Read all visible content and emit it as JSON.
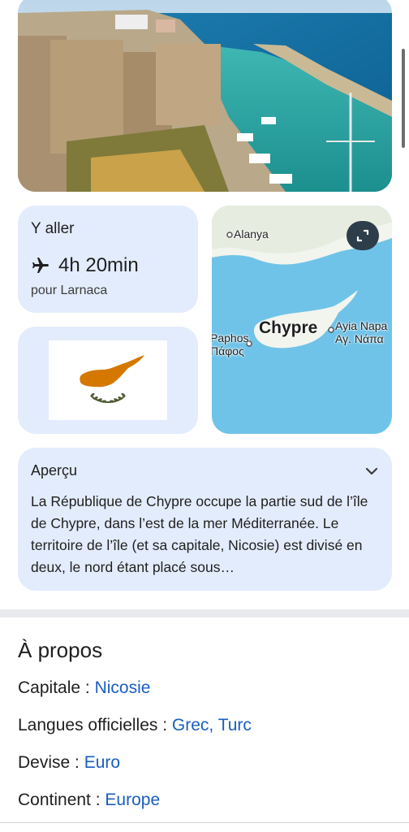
{
  "hero": {
    "alt": "Harbour with castle and boats"
  },
  "travel": {
    "title": "Y aller",
    "duration": "4h 20min",
    "destination": "pour Larnaca"
  },
  "map": {
    "labels": {
      "alanya": "Alanya",
      "chypre": "Chypre",
      "ayia_napa": "Ayia Napa",
      "ayia_napa_gr": "Αγ. Νάπα",
      "paphos": "Paphos",
      "paphos_gr": "Πάφος"
    }
  },
  "overview": {
    "title": "Aperçu",
    "text": "La République de Chypre occupe la partie sud de l’île de Chypre, dans l’est de la mer Méditerranée. Le territoire de l’île (et sa capitale, Nicosie) est divisé en deux, le nord étant placé sous…"
  },
  "about": {
    "title": "À propos",
    "facts": [
      {
        "label": "Capitale : ",
        "value": "Nicosie"
      },
      {
        "label": "Langues officielles : ",
        "value": "Grec, Turc"
      },
      {
        "label": "Devise : ",
        "value": "Euro"
      },
      {
        "label": "Continent : ",
        "value": "Europe"
      }
    ]
  },
  "colors": {
    "card_bg": "#e3ecfc",
    "link": "#1a5ec0",
    "sea": "#6fc3e8",
    "land": "#f2f4ee",
    "flag_orange": "#d57800",
    "flag_green": "#4e5b31"
  },
  "icons": [
    "airplane-icon",
    "expand-icon",
    "chevron-down-icon"
  ]
}
